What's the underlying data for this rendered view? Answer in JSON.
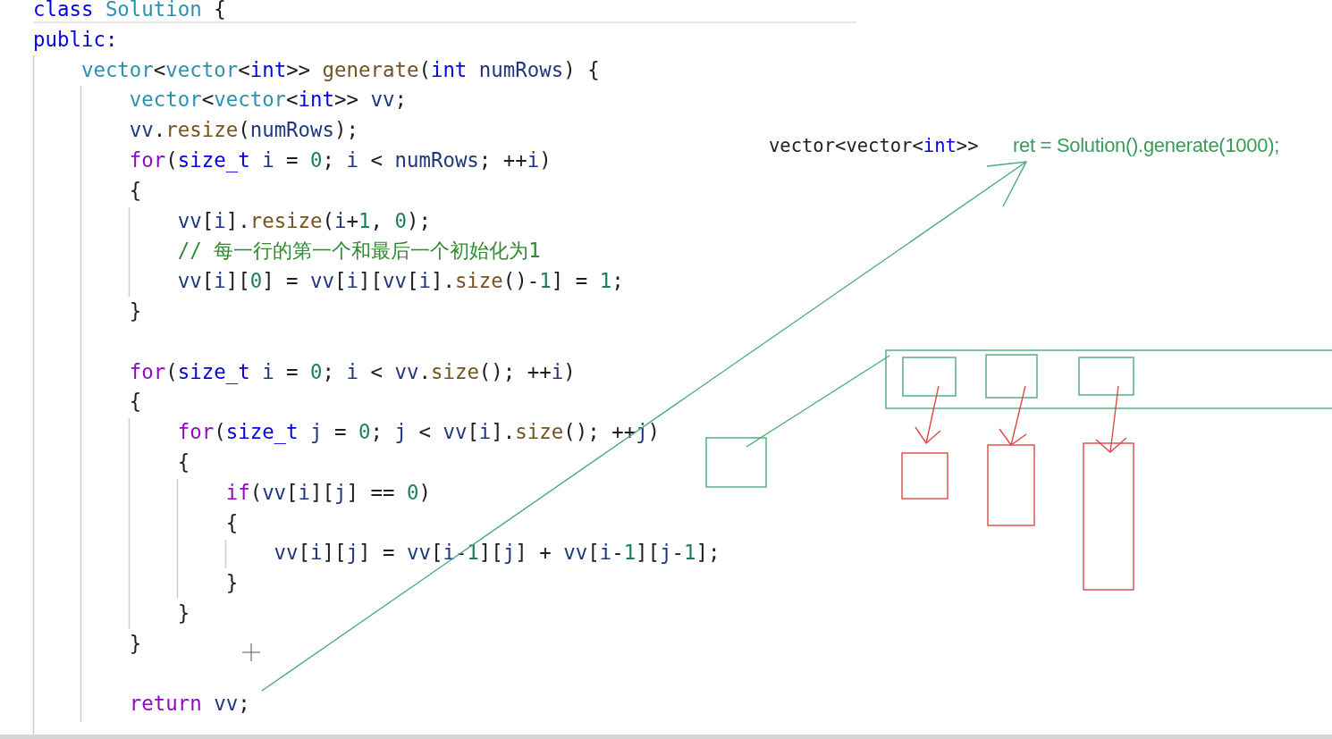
{
  "editor": {
    "lines": [
      {
        "kind": "code",
        "tokens": [
          {
            "text": "class",
            "kind": "kw"
          },
          {
            "text": " Solution",
            "kind": "type"
          },
          {
            "text": " {",
            "kind": "plain"
          }
        ]
      },
      {
        "kind": "code",
        "tokens": [
          {
            "text": "public:",
            "kind": "kw"
          }
        ]
      },
      {
        "kind": "code",
        "tokens": [
          {
            "text": "    vector",
            "kind": "type"
          },
          {
            "text": "<",
            "kind": "plain"
          },
          {
            "text": "vector",
            "kind": "type"
          },
          {
            "text": "<",
            "kind": "plain"
          },
          {
            "text": "int",
            "kind": "kw"
          },
          {
            "text": ">> ",
            "kind": "plain"
          },
          {
            "text": "generate",
            "kind": "fn"
          },
          {
            "text": "(",
            "kind": "plain"
          },
          {
            "text": "int",
            "kind": "kw"
          },
          {
            "text": " numRows",
            "kind": "var"
          },
          {
            "text": ") {",
            "kind": "plain"
          }
        ]
      },
      {
        "kind": "code",
        "tokens": [
          {
            "text": "        vector",
            "kind": "type"
          },
          {
            "text": "<",
            "kind": "plain"
          },
          {
            "text": "vector",
            "kind": "type"
          },
          {
            "text": "<",
            "kind": "plain"
          },
          {
            "text": "int",
            "kind": "kw"
          },
          {
            "text": ">> ",
            "kind": "plain"
          },
          {
            "text": "vv",
            "kind": "var"
          },
          {
            "text": ";",
            "kind": "plain"
          }
        ]
      },
      {
        "kind": "code",
        "tokens": [
          {
            "text": "        vv",
            "kind": "var"
          },
          {
            "text": ".",
            "kind": "plain"
          },
          {
            "text": "resize",
            "kind": "fn"
          },
          {
            "text": "(",
            "kind": "plain"
          },
          {
            "text": "numRows",
            "kind": "var"
          },
          {
            "text": ");",
            "kind": "plain"
          }
        ]
      },
      {
        "kind": "code",
        "tokens": [
          {
            "text": "        for",
            "kind": "ctrl"
          },
          {
            "text": "(",
            "kind": "plain"
          },
          {
            "text": "size_t",
            "kind": "kw"
          },
          {
            "text": " i",
            "kind": "var"
          },
          {
            "text": " = ",
            "kind": "plain"
          },
          {
            "text": "0",
            "kind": "num"
          },
          {
            "text": "; ",
            "kind": "plain"
          },
          {
            "text": "i",
            "kind": "var"
          },
          {
            "text": " < ",
            "kind": "plain"
          },
          {
            "text": "numRows",
            "kind": "var"
          },
          {
            "text": "; ++",
            "kind": "plain"
          },
          {
            "text": "i",
            "kind": "var"
          },
          {
            "text": ")",
            "kind": "plain"
          }
        ]
      },
      {
        "kind": "code",
        "tokens": [
          {
            "text": "        {",
            "kind": "plain"
          }
        ]
      },
      {
        "kind": "code",
        "tokens": [
          {
            "text": "            vv",
            "kind": "var"
          },
          {
            "text": "[",
            "kind": "plain"
          },
          {
            "text": "i",
            "kind": "var"
          },
          {
            "text": "].",
            "kind": "plain"
          },
          {
            "text": "resize",
            "kind": "fn"
          },
          {
            "text": "(",
            "kind": "plain"
          },
          {
            "text": "i",
            "kind": "var"
          },
          {
            "text": "+",
            "kind": "plain"
          },
          {
            "text": "1",
            "kind": "num"
          },
          {
            "text": ", ",
            "kind": "plain"
          },
          {
            "text": "0",
            "kind": "num"
          },
          {
            "text": ");",
            "kind": "plain"
          }
        ]
      },
      {
        "kind": "code",
        "tokens": [
          {
            "text": "            // 每一行的第一个和最后一个初始化为1",
            "kind": "cmt"
          }
        ]
      },
      {
        "kind": "code",
        "tokens": [
          {
            "text": "            vv",
            "kind": "var"
          },
          {
            "text": "[",
            "kind": "plain"
          },
          {
            "text": "i",
            "kind": "var"
          },
          {
            "text": "][",
            "kind": "plain"
          },
          {
            "text": "0",
            "kind": "num"
          },
          {
            "text": "] = ",
            "kind": "plain"
          },
          {
            "text": "vv",
            "kind": "var"
          },
          {
            "text": "[",
            "kind": "plain"
          },
          {
            "text": "i",
            "kind": "var"
          },
          {
            "text": "][",
            "kind": "plain"
          },
          {
            "text": "vv",
            "kind": "var"
          },
          {
            "text": "[",
            "kind": "plain"
          },
          {
            "text": "i",
            "kind": "var"
          },
          {
            "text": "].",
            "kind": "plain"
          },
          {
            "text": "size",
            "kind": "fn"
          },
          {
            "text": "()-",
            "kind": "plain"
          },
          {
            "text": "1",
            "kind": "num"
          },
          {
            "text": "] = ",
            "kind": "plain"
          },
          {
            "text": "1",
            "kind": "num"
          },
          {
            "text": ";",
            "kind": "plain"
          }
        ]
      },
      {
        "kind": "code",
        "tokens": [
          {
            "text": "        }",
            "kind": "plain"
          }
        ]
      },
      {
        "kind": "blank"
      },
      {
        "kind": "code",
        "tokens": [
          {
            "text": "        for",
            "kind": "ctrl"
          },
          {
            "text": "(",
            "kind": "plain"
          },
          {
            "text": "size_t",
            "kind": "kw"
          },
          {
            "text": " i",
            "kind": "var"
          },
          {
            "text": " = ",
            "kind": "plain"
          },
          {
            "text": "0",
            "kind": "num"
          },
          {
            "text": "; ",
            "kind": "plain"
          },
          {
            "text": "i",
            "kind": "var"
          },
          {
            "text": " < ",
            "kind": "plain"
          },
          {
            "text": "vv",
            "kind": "var"
          },
          {
            "text": ".",
            "kind": "plain"
          },
          {
            "text": "size",
            "kind": "fn"
          },
          {
            "text": "(); ++",
            "kind": "plain"
          },
          {
            "text": "i",
            "kind": "var"
          },
          {
            "text": ")",
            "kind": "plain"
          }
        ]
      },
      {
        "kind": "code",
        "tokens": [
          {
            "text": "        {",
            "kind": "plain"
          }
        ]
      },
      {
        "kind": "code",
        "tokens": [
          {
            "text": "            for",
            "kind": "ctrl"
          },
          {
            "text": "(",
            "kind": "plain"
          },
          {
            "text": "size_t",
            "kind": "kw"
          },
          {
            "text": " j",
            "kind": "var"
          },
          {
            "text": " = ",
            "kind": "plain"
          },
          {
            "text": "0",
            "kind": "num"
          },
          {
            "text": "; ",
            "kind": "plain"
          },
          {
            "text": "j",
            "kind": "var"
          },
          {
            "text": " < ",
            "kind": "plain"
          },
          {
            "text": "vv",
            "kind": "var"
          },
          {
            "text": "[",
            "kind": "plain"
          },
          {
            "text": "i",
            "kind": "var"
          },
          {
            "text": "].",
            "kind": "plain"
          },
          {
            "text": "size",
            "kind": "fn"
          },
          {
            "text": "(); ++",
            "kind": "plain"
          },
          {
            "text": "j",
            "kind": "var"
          },
          {
            "text": ")",
            "kind": "plain"
          }
        ]
      },
      {
        "kind": "code",
        "tokens": [
          {
            "text": "            {",
            "kind": "plain"
          }
        ]
      },
      {
        "kind": "code",
        "tokens": [
          {
            "text": "                if",
            "kind": "ctrl"
          },
          {
            "text": "(",
            "kind": "plain"
          },
          {
            "text": "vv",
            "kind": "var"
          },
          {
            "text": "[",
            "kind": "plain"
          },
          {
            "text": "i",
            "kind": "var"
          },
          {
            "text": "][",
            "kind": "plain"
          },
          {
            "text": "j",
            "kind": "var"
          },
          {
            "text": "] == ",
            "kind": "plain"
          },
          {
            "text": "0",
            "kind": "num"
          },
          {
            "text": ")",
            "kind": "plain"
          }
        ]
      },
      {
        "kind": "code",
        "tokens": [
          {
            "text": "                {",
            "kind": "plain"
          }
        ]
      },
      {
        "kind": "code",
        "tokens": [
          {
            "text": "                    vv",
            "kind": "var"
          },
          {
            "text": "[",
            "kind": "plain"
          },
          {
            "text": "i",
            "kind": "var"
          },
          {
            "text": "][",
            "kind": "plain"
          },
          {
            "text": "j",
            "kind": "var"
          },
          {
            "text": "] = ",
            "kind": "plain"
          },
          {
            "text": "vv",
            "kind": "var"
          },
          {
            "text": "[",
            "kind": "plain"
          },
          {
            "text": "i",
            "kind": "var"
          },
          {
            "text": "-",
            "kind": "plain"
          },
          {
            "text": "1",
            "kind": "num"
          },
          {
            "text": "][",
            "kind": "plain"
          },
          {
            "text": "j",
            "kind": "var"
          },
          {
            "text": "] + ",
            "kind": "plain"
          },
          {
            "text": "vv",
            "kind": "var"
          },
          {
            "text": "[",
            "kind": "plain"
          },
          {
            "text": "i",
            "kind": "var"
          },
          {
            "text": "-",
            "kind": "plain"
          },
          {
            "text": "1",
            "kind": "num"
          },
          {
            "text": "][",
            "kind": "plain"
          },
          {
            "text": "j",
            "kind": "var"
          },
          {
            "text": "-",
            "kind": "plain"
          },
          {
            "text": "1",
            "kind": "num"
          },
          {
            "text": "];",
            "kind": "plain"
          }
        ]
      },
      {
        "kind": "code",
        "tokens": [
          {
            "text": "                }",
            "kind": "plain"
          }
        ]
      },
      {
        "kind": "code",
        "tokens": [
          {
            "text": "            }",
            "kind": "plain"
          }
        ]
      },
      {
        "kind": "code",
        "tokens": [
          {
            "text": "        }",
            "kind": "plain"
          }
        ]
      },
      {
        "kind": "blank"
      },
      {
        "kind": "code",
        "tokens": [
          {
            "text": "        return",
            "kind": "ctrl"
          },
          {
            "text": " vv",
            "kind": "var"
          },
          {
            "text": ";",
            "kind": "plain"
          }
        ]
      }
    ]
  },
  "annotation": {
    "code_tokens": [
      {
        "text": "vector",
        "kind": "plain"
      },
      {
        "text": "<",
        "kind": "plain"
      },
      {
        "text": "vector",
        "kind": "plain"
      },
      {
        "text": "<",
        "kind": "plain"
      },
      {
        "text": "int",
        "kind": "kw"
      },
      {
        "text": ">>",
        "kind": "plain"
      }
    ],
    "note": "ret = Solution().generate(1000);"
  }
}
